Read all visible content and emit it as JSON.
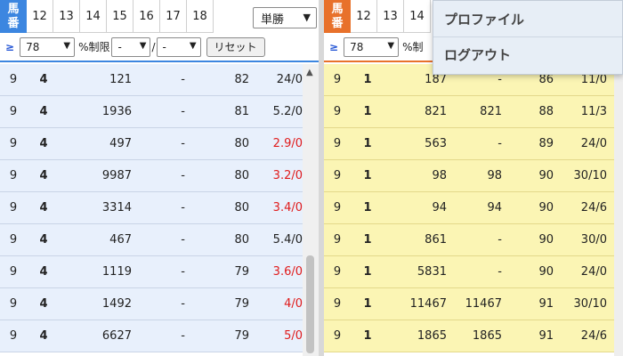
{
  "left_panel": {
    "umaban_label": [
      "馬",
      "番"
    ],
    "header_numbers": [
      "12",
      "13",
      "14",
      "15",
      "16",
      "17",
      "18"
    ],
    "bet_type": "単勝",
    "filter": {
      "ge_symbol": "≥",
      "value": "78",
      "pct_label": "%制限",
      "min": "-",
      "max": "-",
      "slash": "/",
      "reset_label": "リセット"
    },
    "rows": [
      [
        "9",
        "4",
        "121",
        "-",
        "82",
        "24/0"
      ],
      [
        "9",
        "4",
        "1936",
        "-",
        "81",
        "5.2/0"
      ],
      [
        "9",
        "4",
        "497",
        "-",
        "80",
        "2.9/0"
      ],
      [
        "9",
        "4",
        "9987",
        "-",
        "80",
        "3.2/0"
      ],
      [
        "9",
        "4",
        "3314",
        "-",
        "80",
        "3.4/0"
      ],
      [
        "9",
        "4",
        "467",
        "-",
        "80",
        "5.4/0"
      ],
      [
        "9",
        "4",
        "1119",
        "-",
        "79",
        "3.6/0"
      ],
      [
        "9",
        "4",
        "1492",
        "-",
        "79",
        "4/0"
      ],
      [
        "9",
        "4",
        "6627",
        "-",
        "79",
        "5/0"
      ]
    ],
    "red_rows": [
      2,
      3,
      4,
      6,
      7,
      8
    ]
  },
  "right_panel": {
    "umaban_label": [
      "馬",
      "番"
    ],
    "header_numbers": [
      "12",
      "13",
      "14"
    ],
    "filter": {
      "ge_symbol": "≥",
      "value": "78",
      "pct_label": "%制"
    },
    "rows": [
      [
        "9",
        "1",
        "187",
        "-",
        "86",
        "11/0"
      ],
      [
        "9",
        "1",
        "821",
        "821",
        "88",
        "11/3"
      ],
      [
        "9",
        "1",
        "563",
        "-",
        "89",
        "24/0"
      ],
      [
        "9",
        "1",
        "98",
        "98",
        "90",
        "30/10"
      ],
      [
        "9",
        "1",
        "94",
        "94",
        "90",
        "24/6"
      ],
      [
        "9",
        "1",
        "861",
        "-",
        "90",
        "30/0"
      ],
      [
        "9",
        "1",
        "5831",
        "-",
        "90",
        "24/0"
      ],
      [
        "9",
        "1",
        "11467",
        "11467",
        "91",
        "30/10"
      ],
      [
        "9",
        "1",
        "1865",
        "1865",
        "91",
        "24/6"
      ]
    ]
  },
  "menu": {
    "items": [
      "プロファイル",
      "ログアウト"
    ]
  },
  "colors": {
    "left_accent": "#3c86e0",
    "right_accent": "#e8712b",
    "left_row_bg": "#e8f0fc",
    "right_row_bg": "#fbf5b4",
    "odds_red": "#e01c1c"
  }
}
